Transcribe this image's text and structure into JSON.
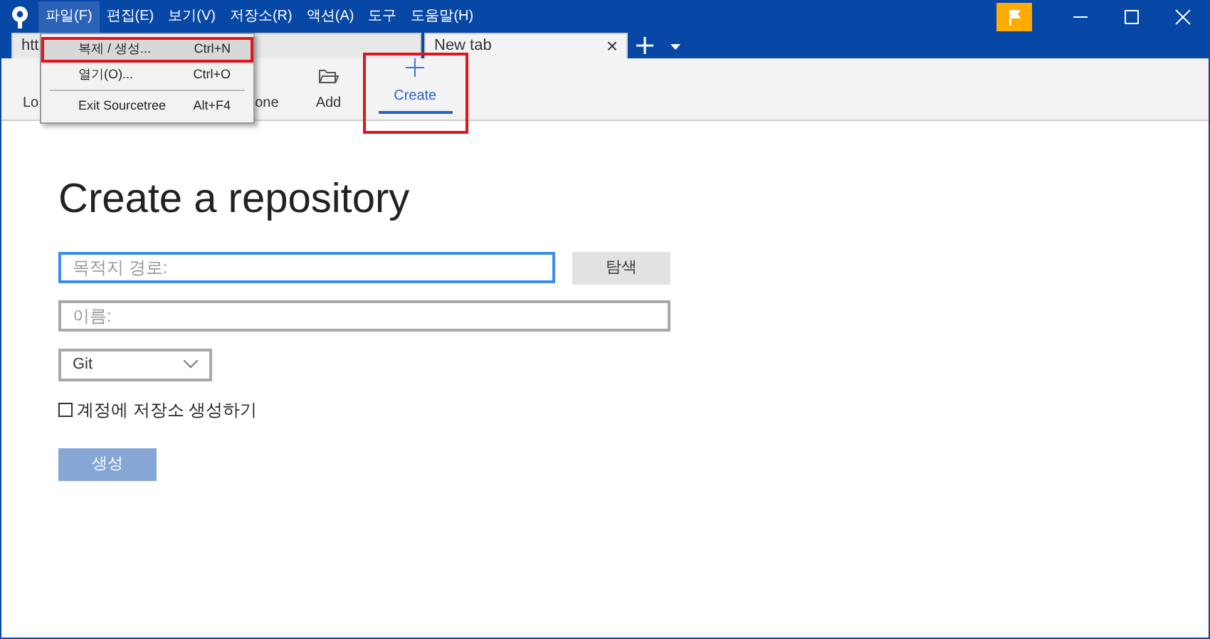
{
  "menu_bar": [
    {
      "label": "파일(F)",
      "selected": true
    },
    {
      "label": "편집(E)",
      "selected": false
    },
    {
      "label": "보기(V)",
      "selected": false
    },
    {
      "label": "저장소(R)",
      "selected": false
    },
    {
      "label": "액션(A)",
      "selected": false
    },
    {
      "label": "도구",
      "selected": false
    },
    {
      "label": "도움말(H)",
      "selected": false
    }
  ],
  "tabs": [
    {
      "label": "htt",
      "selected": false
    },
    {
      "label": "New tab",
      "selected": true,
      "close": "×"
    }
  ],
  "toolbar": [
    {
      "label": "Lo",
      "selected": false,
      "highlighted": false
    },
    {
      "label": "one",
      "selected": false,
      "highlighted": false
    },
    {
      "label": "Add",
      "selected": false,
      "highlighted": false
    },
    {
      "label": "Create",
      "selected": true,
      "highlighted": true
    }
  ],
  "file_menu": [
    {
      "kind": "item",
      "label": "복제 / 생성...",
      "shortcut": "Ctrl+N",
      "highlighted": true
    },
    {
      "kind": "item",
      "label": "열기(O)...",
      "shortcut": "Ctrl+O",
      "highlighted": false
    },
    {
      "kind": "separator"
    },
    {
      "kind": "item",
      "label": "Exit Sourcetree",
      "shortcut": "Alt+F4",
      "highlighted": false
    }
  ],
  "form": {
    "title": "Create a repository",
    "path_field": {
      "placeholder": "목적지 경로:",
      "focused": true
    },
    "browse_button": "탐색",
    "name_field": {
      "placeholder": "이름:"
    },
    "type_select": "Git",
    "account_checkbox": {
      "label": "계정에 저장소 생성하기",
      "checked": false
    },
    "create_button": {
      "label": "생성",
      "disabled": true
    }
  }
}
